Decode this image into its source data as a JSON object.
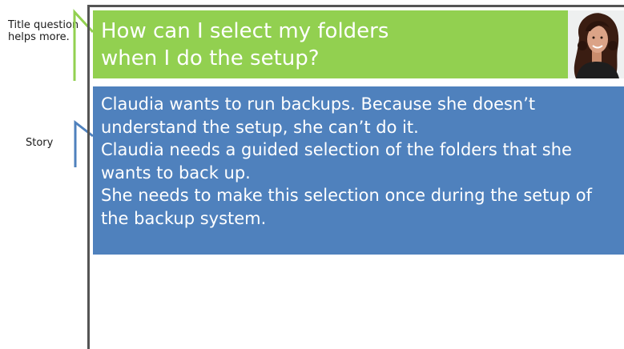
{
  "annotations": {
    "title_note": "Title question helps more.",
    "story_note": "Story"
  },
  "card": {
    "title": "How can I select my folders\nwhen I do the setup?",
    "avatar_icon": "woman-portrait-photo",
    "story": [
      "Claudia wants to run backups. Because she doesn’t understand the setup, she can’t do it.",
      "Claudia needs a guided selection of the folders that she wants to back up.",
      "She needs to make this selection once during the setup of the backup system."
    ]
  },
  "colors": {
    "title_bg": "#92d050",
    "story_bg": "#4f81bd",
    "title_bracket": "#92d050",
    "story_bracket": "#4f81bd",
    "frame": "#545454"
  }
}
